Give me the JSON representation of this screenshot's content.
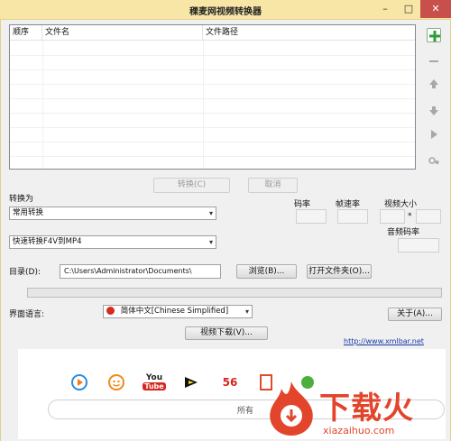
{
  "window": {
    "title": "稞麦网视频转换器",
    "minimize_glyph": "–",
    "maximize_glyph": "□",
    "close_glyph": "✕"
  },
  "file_list": {
    "columns": [
      "顺序",
      "文件名",
      "文件路径"
    ],
    "rows": []
  },
  "side_toolbar": {
    "icons": [
      "add-icon",
      "remove-icon",
      "move-up-icon",
      "move-down-icon",
      "play-icon",
      "settings-icon"
    ]
  },
  "actions": {
    "convert_label": "转换(C)",
    "cancel_label": "取消"
  },
  "convert_to": {
    "label": "转换为",
    "category_value": "常用转换",
    "preset_value": "快速转换F4V到MP4"
  },
  "stats": {
    "bitrate_label": "码率",
    "framerate_label": "帧速率",
    "video_size_label": "视频大小",
    "size_separator": "*",
    "audio_bitrate_label": "音频码率"
  },
  "directory": {
    "label": "目录(D):",
    "value": "C:\\Users\\Administrator\\Documents\\",
    "browse_label": "浏览(B)...",
    "open_folder_label": "打开文件夹(O)..."
  },
  "language": {
    "label": "界面语言:",
    "value": "简体中文[Chinese Simplified]",
    "about_label": "关于(A)..."
  },
  "video_download_label": "视频下载(V)...",
  "website_link": "http://www.xmlbar.net",
  "site_panel": {
    "sites": [
      "tencent-video-icon",
      "tudou-icon",
      "youtube-icon",
      "youku-icon",
      "56-icon",
      "sohu-icon",
      "iqiyi-icon"
    ],
    "youtube_top": "You",
    "youtube_bottom": "Tube",
    "site_56": "56",
    "search_placeholder": "所有"
  },
  "watermark": {
    "brand": "下载火",
    "domain": "xiazaihuo.com"
  },
  "colors": {
    "titlebar": "#f7e6a6",
    "accent_green": "#2e9d3b",
    "link_blue": "#1a3aa8",
    "watermark_red": "#e2452b"
  }
}
